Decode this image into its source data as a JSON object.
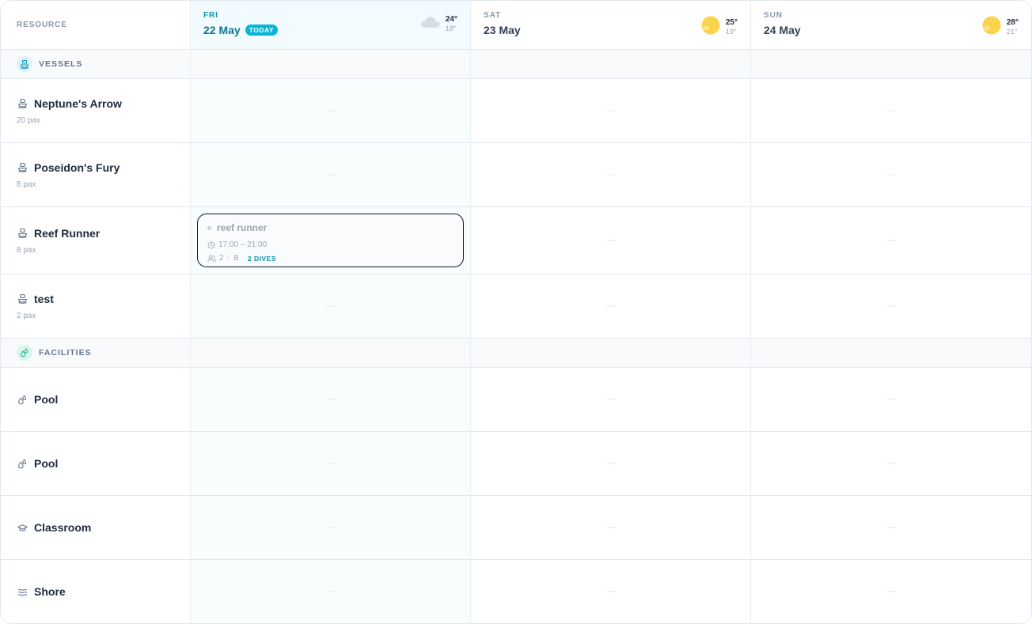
{
  "header": {
    "resource_label": "RESOURCE",
    "days": [
      {
        "dow": "FRI",
        "date": "22 May",
        "today_label": "TODAY",
        "weather_icon": "cloud-icon",
        "high": "24°",
        "low": "18°"
      },
      {
        "dow": "SAT",
        "date": "23 May",
        "weather_icon": "sun-icon",
        "high": "25°",
        "low": "19°"
      },
      {
        "dow": "SUN",
        "date": "24 May",
        "weather_icon": "sun-icon",
        "high": "28°",
        "low": "21°"
      }
    ]
  },
  "groups": {
    "vessels": {
      "label": "VESSELS",
      "icon": "boat-icon",
      "items": [
        {
          "name": "Neptune's Arrow",
          "capacity": "20 pax"
        },
        {
          "name": "Poseidon's Fury",
          "capacity": "8 pax"
        },
        {
          "name": "Reef Runner",
          "capacity": "8 pax"
        },
        {
          "name": "test",
          "capacity": "2 pax"
        }
      ]
    },
    "facilities": {
      "label": "FACILITIES",
      "icon": "drops-icon",
      "items": [
        {
          "name": "Pool",
          "icon": "drops-icon"
        },
        {
          "name": "Pool",
          "icon": "drops-icon"
        },
        {
          "name": "Classroom",
          "icon": "graduation-cap-icon"
        },
        {
          "name": "Shore",
          "icon": "waves-icon"
        }
      ]
    }
  },
  "booking": {
    "title": "reef runner",
    "time": "17:00 – 21:00",
    "booked": "2",
    "separator": "/",
    "capacity": "8",
    "badge": "2 DIVES"
  },
  "colors": {
    "accent": "#06b6d4",
    "today_bg": "#f2fbfd",
    "sun": "#fcd34d",
    "cloud": "#d8dde4"
  }
}
